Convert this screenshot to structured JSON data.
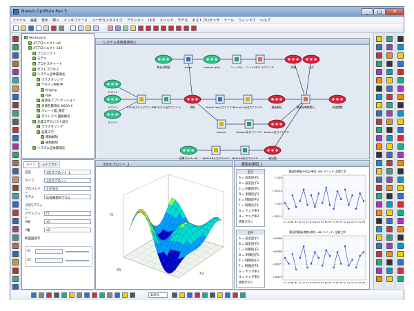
{
  "window": {
    "title": "Noesis OptiRule Rev 5"
  },
  "menu": [
    "ファイル",
    "編集",
    "表示",
    "挿入",
    "インタフェース",
    "ユーザカスタマイズ",
    "アクション",
    "UCD",
    "メソッド",
    "モデル",
    "ポストプロセッサ",
    "ツール",
    "ウィンドウ",
    "ヘルプ"
  ],
  "tree": {
    "items": [
      {
        "label": "Workspace",
        "indent": 0
      },
      {
        "label": "ATプロジェクト-a9",
        "indent": 1
      },
      {
        "label": "ATプロジェクト-a10",
        "indent": 1
      },
      {
        "label": "プロジェクト",
        "indent": 2
      },
      {
        "label": "モデル",
        "indent": 2
      },
      {
        "label": "プロセスチャート",
        "indent": 2
      },
      {
        "label": "ポストプロセス",
        "indent": 2
      },
      {
        "label": "システム全体最適化",
        "indent": 2
      },
      {
        "label": "クラスタリング",
        "indent": 3
      },
      {
        "label": "テキスト解析中",
        "indent": 3
      },
      {
        "label": "Kriging",
        "indent": 4
      },
      {
        "label": "RBF",
        "indent": 4
      },
      {
        "label": "最適化アプリケーション",
        "indent": 3
      },
      {
        "label": "多目的最適化 NSGA-II",
        "indent": 3
      },
      {
        "label": "パレート図_確定",
        "indent": 3
      },
      {
        "label": "ポストスペ-図解解答",
        "indent": 3
      },
      {
        "label": "品質工学ロバスト設計",
        "indent": 2
      },
      {
        "label": "クラスタリング",
        "indent": 3
      },
      {
        "label": "品質工学",
        "indent": 3
      },
      {
        "label": "補助解除",
        "indent": 4
      },
      {
        "label": "補助解除",
        "indent": 4
      },
      {
        "label": "システム全体最適化",
        "indent": 2
      }
    ]
  },
  "props": {
    "tabs": [
      "メイン",
      "レイアウト"
    ],
    "rows": [
      {
        "label": "名前",
        "value": "3次元プロット_1"
      },
      {
        "label": "タイプ",
        "value": "3次元プロット"
      },
      {
        "label": "プロジェクト",
        "value": "3 RFDO"
      },
      {
        "label": "モデル",
        "value": "応答曲面モデル1"
      },
      {
        "label": "3次元プロット",
        "value": ""
      },
      {
        "label": "アウトプット",
        "value": "f1"
      },
      {
        "label": "X軸",
        "value": "x1"
      },
      {
        "label": "Y軸",
        "value": "x2"
      },
      {
        "label": "断面図表示",
        "value": ""
      }
    ],
    "x1_label": "X1",
    "x2_label": "X2"
  },
  "flow": {
    "window_title": "システム全体最適化2",
    "nodes": [
      {
        "label": "解析初期値",
        "kind": "green"
      },
      {
        "label": "Ansys",
        "kind": "square"
      },
      {
        "label": "nastran_Kbo",
        "kind": "green"
      },
      {
        "label": "ソートRK",
        "kind": "square"
      },
      {
        "label": "ソートRKエ-ラファイル",
        "kind": "square"
      },
      {
        "label": "評価",
        "kind": "red"
      },
      {
        "label": "出力",
        "kind": "red"
      },
      {
        "label": "テスト1",
        "kind": "green"
      },
      {
        "label": "テスト2",
        "kind": "green"
      },
      {
        "label": "テスト3",
        "kind": "green"
      },
      {
        "label": "CADモデル入力ファイル",
        "kind": "square"
      },
      {
        "label": "CADモデル出力ファイル",
        "kind": "square"
      },
      {
        "label": "規則",
        "kind": "red"
      },
      {
        "label": "Virtual.lab入力ファイル",
        "kind": "square"
      },
      {
        "label": "Virtual.lab出力ファイル",
        "kind": "square"
      },
      {
        "label": "構造解析",
        "kind": "red"
      },
      {
        "label": "最適化戦略実行",
        "kind": "square"
      },
      {
        "label": "評価関数",
        "kind": "red"
      },
      {
        "label": "Abaqus",
        "kind": "square"
      },
      {
        "label": "Abaqus出力ファイル",
        "kind": "square"
      },
      {
        "label": "Abaqus出力ファイル",
        "kind": "red"
      },
      {
        "label": "初期パラメータ",
        "kind": "green"
      },
      {
        "label": "MATLAB入力ファイル",
        "kind": "square"
      },
      {
        "label": "MATLAB出力ファイル",
        "kind": "square"
      },
      {
        "label": "抽出値",
        "kind": "red"
      }
    ]
  },
  "plot3d": {
    "window_title": "3次元プロット_1",
    "axis_labels": [
      "X1",
      "X2",
      "f1"
    ],
    "colors": [
      "#0000c8",
      "#00a0ff",
      "#00e0d0",
      "#7cff4c",
      "#ffe800"
    ]
  },
  "factor": {
    "window_title": "要因効果図_1",
    "list1": {
      "title": "因子",
      "items": [
        "A = 誤差因子1",
        "B = 誤差因子2",
        "C = 制御因子1",
        "D = 制御因子2",
        "E = 制御因子3",
        "F = 制御因子4",
        "G = ヤング率1",
        "H = ヤング率2",
        "更新ボタン"
      ]
    },
    "list2": {
      "title": "因子",
      "items": [
        "A = 誤差因子1",
        "B = 誤差因子2",
        "C = 制御因子1",
        "D = 制御因子2",
        "E = 制御因子3",
        "F = 制御因子4",
        "G = ヤング率1",
        "H = ヤング率2",
        "更新ボタン"
      ]
    },
    "chart1": {
      "title": "要因効果図(SN比)(単位: dB) メソッド: 品質工学",
      "yticks": [
        "+1524",
        "+1523.5",
        "+1523",
        "+1522.5"
      ]
    },
    "chart2": {
      "title": "要因効果図(感度)(単位: dB) メソッド: 品質工学",
      "yticks": [
        "+58585",
        "+58580",
        "+58575",
        "+58570"
      ]
    },
    "xlabels": [
      "A1",
      "A2",
      "B1",
      "B2",
      "C1",
      "C2",
      "C3",
      "D1",
      "D2",
      "D3",
      "E1",
      "E2",
      "E3",
      "F1",
      "F2",
      "F3",
      "G1",
      "G2",
      "G3",
      "H1",
      "H2",
      "H3"
    ]
  },
  "status": {
    "zoom": "100%"
  },
  "chart_data": [
    {
      "type": "line",
      "title": "要因効果図(SN比)(単位: dB) メソッド: 品質工学",
      "x": [
        "A1",
        "A2",
        "B1",
        "B2",
        "C1",
        "C2",
        "C3",
        "D1",
        "D2",
        "D3",
        "E1",
        "E2",
        "E3",
        "F1",
        "F2",
        "F3",
        "G1",
        "G2",
        "G3",
        "H1",
        "H2",
        "H3"
      ],
      "series": [
        {
          "values": [
            0.35,
            0.2,
            0.55,
            0.25,
            0.4,
            0.7,
            0.3,
            0.55,
            0.25,
            0.6,
            0.35,
            0.75,
            0.3,
            0.2,
            0.65,
            0.45,
            0.7,
            0.3,
            0.55,
            0.2,
            0.6,
            0.4
          ]
        }
      ],
      "ylim": [
        0,
        1
      ],
      "note_units": "relative"
    },
    {
      "type": "line",
      "title": "要因効果図(感度)(単位: dB) メソッド: 品質工学",
      "x": [
        "A1",
        "A2",
        "B1",
        "B2",
        "C1",
        "C2",
        "C3",
        "D1",
        "D2",
        "D3",
        "E1",
        "E2",
        "E3",
        "F1",
        "F2",
        "F3",
        "G1",
        "G2",
        "G3",
        "H1",
        "H2",
        "H3"
      ],
      "series": [
        {
          "values": [
            0.5,
            0.35,
            0.6,
            0.2,
            0.5,
            0.8,
            0.25,
            0.35,
            0.65,
            0.5,
            0.3,
            0.7,
            0.55,
            0.25,
            0.65,
            0.35,
            0.8,
            0.3,
            0.45,
            0.25,
            0.55,
            0.65
          ]
        }
      ],
      "ylim": [
        0,
        1
      ]
    }
  ]
}
